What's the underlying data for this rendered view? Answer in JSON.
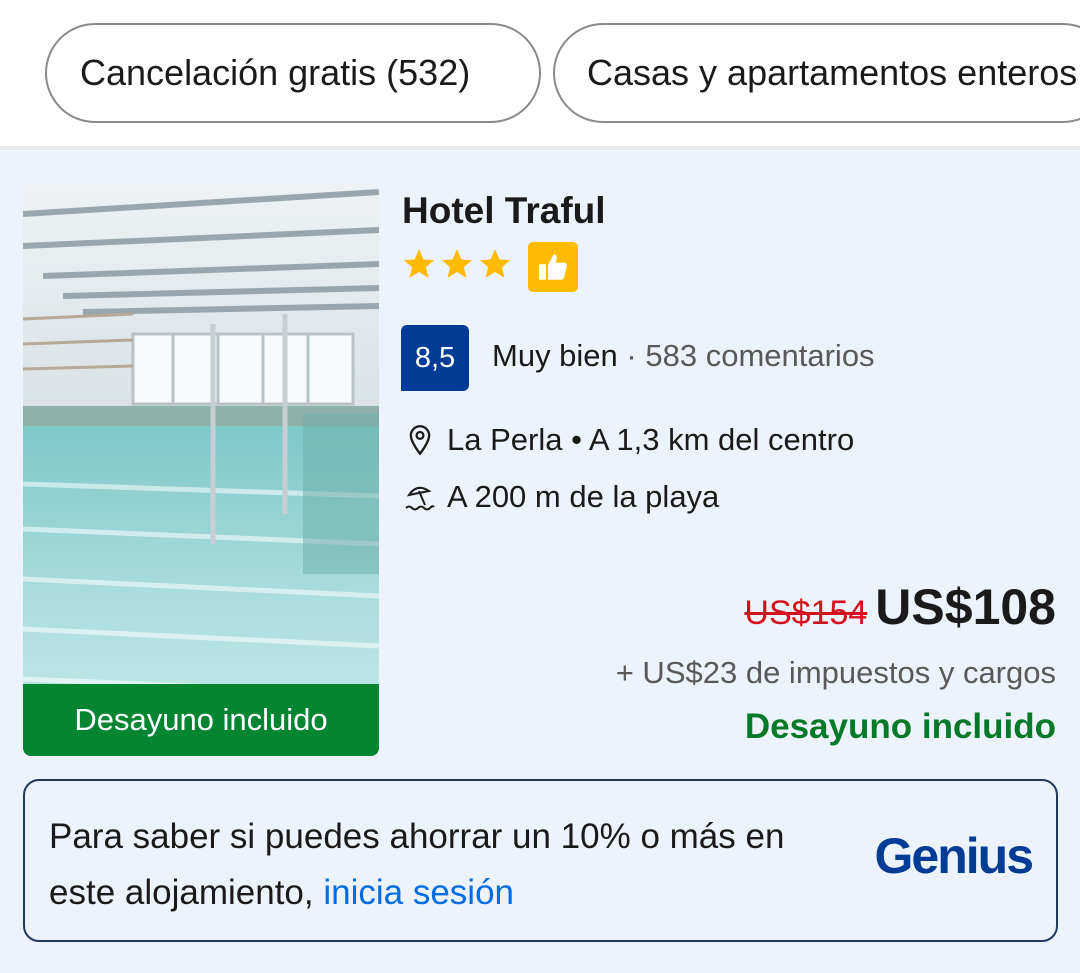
{
  "filters": {
    "chip_1": "Cancelación gratis (532)",
    "chip_2": "Casas y apartamentos enteros"
  },
  "hotel": {
    "name": "Hotel Traful",
    "stars": 3,
    "photo_badge": "Desayuno incluido",
    "score": "8,5",
    "score_label": "Muy bien",
    "score_separator": "·",
    "reviews": "583 comentarios",
    "location": "La Perla • A 1,3 km del centro",
    "beach": "A 200 m de la playa",
    "old_price": "US$154",
    "price": "US$108",
    "taxes": "+ US$23 de impuestos y cargos",
    "breakfast": "Desayuno incluido"
  },
  "genius": {
    "text": "Para saber si puedes ahorrar un 10% o más en este alojamiento,",
    "link": "inicia sesión",
    "logo": "Genius"
  },
  "colors": {
    "card_bg": "#edf3fc",
    "score_bg": "#003b95",
    "breakfast_green": "#047a28",
    "old_price_red": "#d4111e",
    "star_yellow": "#febb02",
    "link_blue": "#006ce4"
  },
  "icons": [
    "star-icon",
    "thumbs-up-icon",
    "map-pin-icon",
    "beach-umbrella-icon"
  ]
}
